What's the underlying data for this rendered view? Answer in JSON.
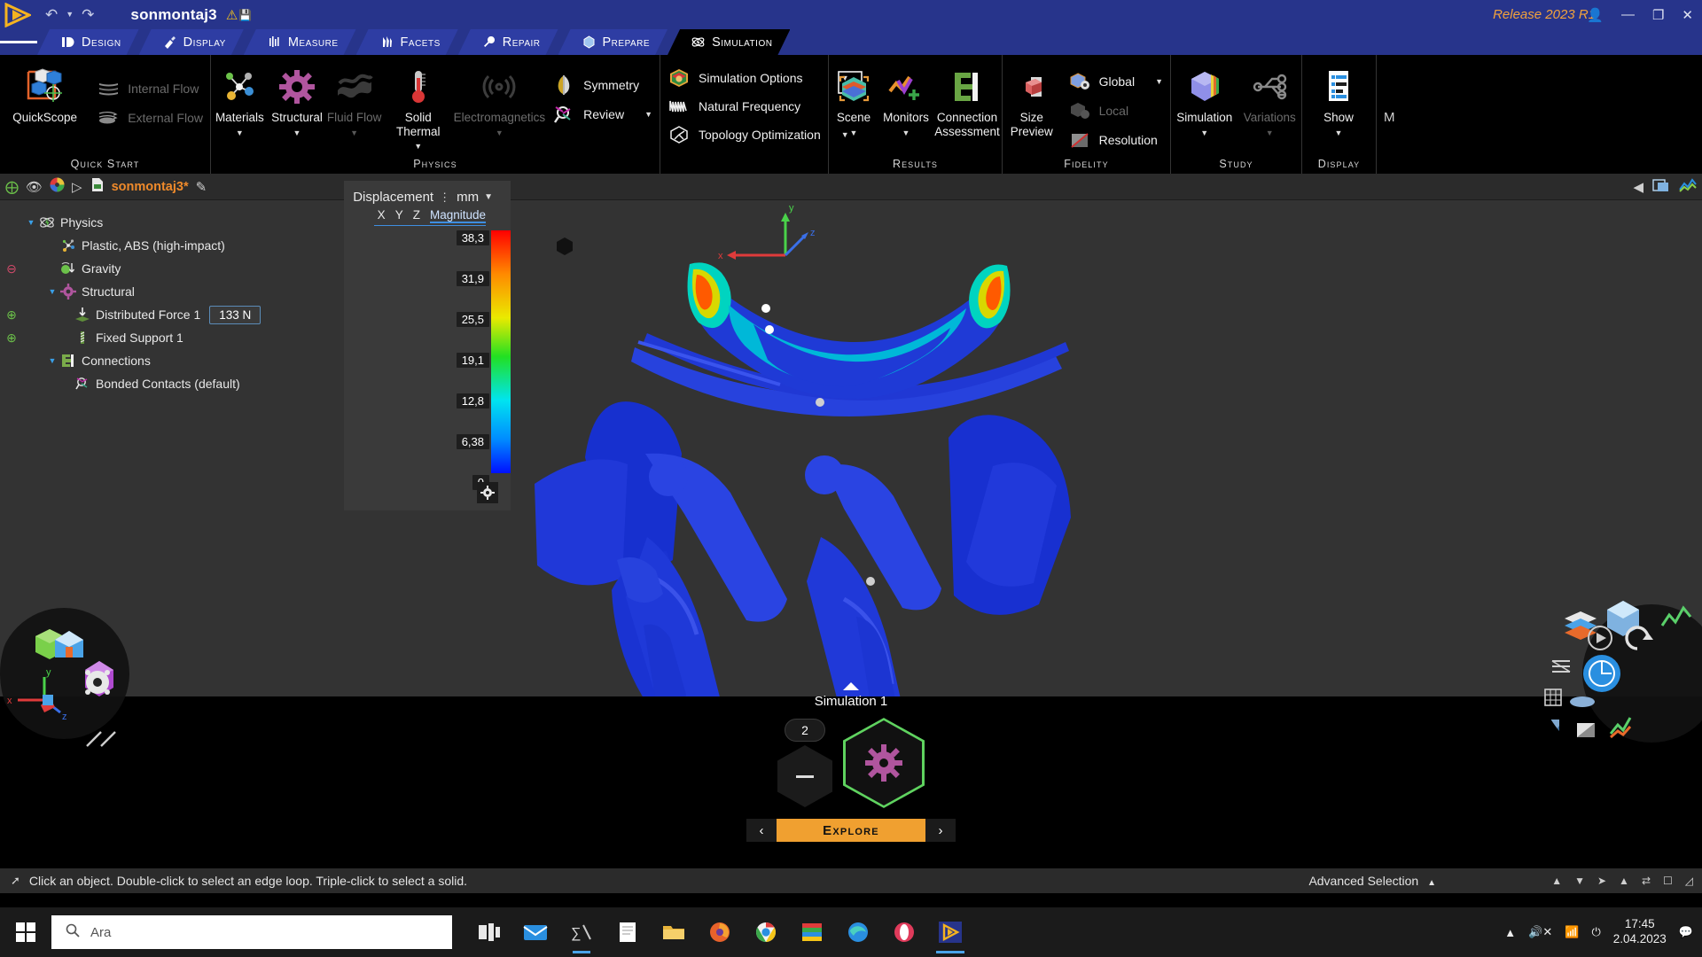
{
  "titlebar": {
    "doc_title": "sonmontaj3",
    "release": "Release 2023 R1",
    "undo_label": "undo-arrow",
    "redo_label": "redo-arrow",
    "minimize": "—",
    "maximize": "❐",
    "close": "✕"
  },
  "tabs": [
    {
      "label": "Design",
      "icon": "design-icon",
      "active": false
    },
    {
      "label": "Display",
      "icon": "display-icon",
      "active": false
    },
    {
      "label": "Measure",
      "icon": "measure-icon",
      "active": false
    },
    {
      "label": "Facets",
      "icon": "facets-icon",
      "active": false
    },
    {
      "label": "Repair",
      "icon": "repair-icon",
      "active": false
    },
    {
      "label": "Prepare",
      "icon": "prepare-icon",
      "active": false
    },
    {
      "label": "Simulation",
      "icon": "simulation-icon",
      "active": true
    }
  ],
  "ribbon": {
    "groups": [
      {
        "title": "Quick Start",
        "big": [
          {
            "label": "QuickScope",
            "enabled": true,
            "caret": false
          }
        ],
        "small": [
          {
            "label": "Internal Flow",
            "enabled": false,
            "caret": false
          },
          {
            "label": "External Flow",
            "enabled": false,
            "caret": false
          }
        ]
      },
      {
        "title": "Physics",
        "big": [
          {
            "label": "Materials",
            "enabled": true,
            "caret": true
          },
          {
            "label": "Structural",
            "enabled": true,
            "caret": true
          },
          {
            "label": "Fluid Flow",
            "enabled": false,
            "caret": true
          },
          {
            "label": "Solid Thermal",
            "enabled": true,
            "caret": true
          },
          {
            "label": "Electromagnetics",
            "enabled": false,
            "caret": true
          }
        ],
        "small": [
          {
            "label": "Symmetry",
            "enabled": true,
            "caret": false
          },
          {
            "label": "Review",
            "enabled": true,
            "caret": true
          }
        ]
      },
      {
        "title": "",
        "big": [],
        "small": [
          {
            "label": "Simulation Options",
            "enabled": true,
            "caret": true
          },
          {
            "label": "Natural Frequency",
            "enabled": true,
            "caret": false
          },
          {
            "label": "Topology Optimization",
            "enabled": true,
            "caret": true
          }
        ]
      },
      {
        "title": "Results",
        "big": [
          {
            "label": "Scene",
            "enabled": true,
            "caret": true
          },
          {
            "label": "Monitors",
            "enabled": true,
            "caret": true
          },
          {
            "label": "Connection Assessment",
            "enabled": true,
            "caret": false
          }
        ],
        "small": []
      },
      {
        "title": "Fidelity",
        "big": [
          {
            "label": "Size Preview",
            "enabled": true,
            "caret": false
          }
        ],
        "small": [
          {
            "label": "Global",
            "enabled": true,
            "caret": true
          },
          {
            "label": "Local",
            "enabled": false,
            "caret": false
          },
          {
            "label": "Resolution",
            "enabled": true,
            "caret": false
          }
        ]
      },
      {
        "title": "Study",
        "big": [
          {
            "label": "Simulation",
            "enabled": true,
            "caret": true
          },
          {
            "label": "Variations",
            "enabled": false,
            "caret": true
          }
        ],
        "small": []
      },
      {
        "title": "Display",
        "big": [
          {
            "label": "Show",
            "enabled": true,
            "caret": true
          }
        ],
        "small": []
      }
    ]
  },
  "structure_bar": {
    "doc_name": "sonmontaj3*"
  },
  "tree": {
    "items": [
      {
        "label": "Physics",
        "depth": 0,
        "twisty": "▼",
        "icon": "physics-icon",
        "gutter": "",
        "value": ""
      },
      {
        "label": "Plastic, ABS (high-impact)",
        "depth": 1,
        "twisty": "",
        "icon": "material-icon",
        "gutter": "",
        "value": ""
      },
      {
        "label": "Gravity",
        "depth": 1,
        "twisty": "",
        "icon": "gravity-icon",
        "gutter": "⊖",
        "value": ""
      },
      {
        "label": "Structural",
        "depth": 1,
        "twisty": "▼",
        "icon": "structural-icon",
        "gutter": "",
        "value": ""
      },
      {
        "label": "Distributed Force 1",
        "depth": 2,
        "twisty": "",
        "icon": "force-icon",
        "gutter": "⊕",
        "value": "133 N"
      },
      {
        "label": "Fixed Support 1",
        "depth": 2,
        "twisty": "",
        "icon": "support-icon",
        "gutter": "⊕",
        "value": ""
      },
      {
        "label": "Connections",
        "depth": 1,
        "twisty": "▼",
        "icon": "connections-icon",
        "gutter": "",
        "value": ""
      },
      {
        "label": "Bonded Contacts (default)",
        "depth": 2,
        "twisty": "",
        "icon": "contacts-icon",
        "gutter": "",
        "value": ""
      }
    ]
  },
  "legend": {
    "title": "Displacement",
    "unit": "mm",
    "components": [
      "X",
      "Y",
      "Z",
      "Magnitude"
    ],
    "selected_component": "Magnitude",
    "ticks": [
      "38,3",
      "31,9",
      "25,5",
      "19,1",
      "12,8",
      "6,38",
      "0"
    ],
    "max": 38.3,
    "min": 0,
    "gear": "gear-icon"
  },
  "sim_stage": {
    "label": "Simulation 1",
    "step_count": "2",
    "explore_label": "Explore",
    "prev": "‹",
    "next": "›"
  },
  "status": {
    "message": "Click an object. Double-click to select an edge loop. Triple-click to select a solid.",
    "advanced_selection": "Advanced Selection"
  },
  "taskbar": {
    "search_placeholder": "Ara",
    "time": "17:45",
    "date": "2.04.2023"
  },
  "colors": {
    "titlebar_blue": "#27348b",
    "tab_blue": "#2e3da3",
    "accent_orange": "#ef8a2b",
    "explore_orange": "#f0a030",
    "panel_gray": "#333333",
    "legend_gray": "#3a3a3a",
    "model_blue": "#1a35d8"
  }
}
